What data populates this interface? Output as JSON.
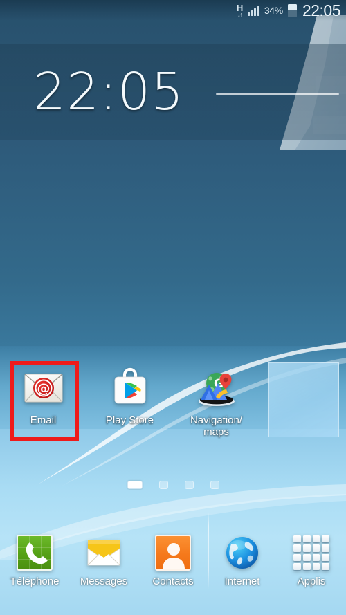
{
  "status_bar": {
    "network_type": "H",
    "network_arrows": "↓↑",
    "network_icon": "hspa-data-icon",
    "signal_icon": "signal-bars-icon",
    "battery_percent": "34%",
    "battery_icon": "battery-icon",
    "clock": "22:05"
  },
  "clock_widget": {
    "time": "22:05",
    "separator_icon": "dashed-divider",
    "weather_line_icon": "horizontal-rule"
  },
  "apps": [
    {
      "label": "Email",
      "icon": "email-envelope-at-icon",
      "selected": true
    },
    {
      "label": "Play Store",
      "icon": "play-store-bag-icon",
      "selected": false
    },
    {
      "label": "Navigation/\nmaps",
      "label_line1": "Navigation/",
      "label_line2": "maps",
      "icon": "maps-folder-icon",
      "selected": false
    },
    {
      "label": "",
      "icon": "widget-placeholder",
      "selected": false
    }
  ],
  "page_indicator": {
    "total": 4,
    "active_index": 0,
    "home_index": 3
  },
  "dock": [
    {
      "label": "Téléphone",
      "icon": "phone-handset-icon"
    },
    {
      "label": "Messages",
      "icon": "message-envelope-icon"
    },
    {
      "label": "Contacts",
      "icon": "contacts-person-icon"
    },
    {
      "label": "Internet",
      "icon": "globe-browser-icon"
    },
    {
      "label": "Applis",
      "icon": "app-drawer-grid-icon"
    }
  ],
  "colors": {
    "selection_red": "#ee1b1b",
    "wallpaper_dark": "#2a5471",
    "wallpaper_light": "#b6e3f7",
    "phone_green": "#55a015",
    "contacts_orange": "#f5791b",
    "messages_yellow": "#f6c518",
    "email_red": "#d41e1e"
  }
}
